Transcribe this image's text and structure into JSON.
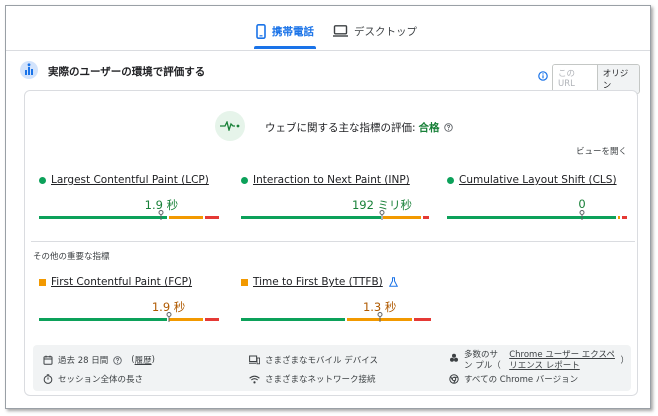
{
  "tabs": {
    "mobile_label": "携帯電話",
    "desktop_label": "デスクトップ"
  },
  "section": {
    "title": "実際のユーザーの環境で評価する",
    "toggle_url": "この URL",
    "toggle_origin": "オリジン"
  },
  "assessment": {
    "label": "ウェブに関する主な指標の評価:",
    "result": "合格",
    "expand": "ビューを開く"
  },
  "core_metrics": [
    {
      "name": "Largest Contentful Paint (LCP)",
      "value": "1.9 秒",
      "status": "good",
      "distribution": [
        0.73,
        0.19,
        0.08
      ],
      "marker_fraction": 0.68
    },
    {
      "name": "Interaction to Next Paint (INP)",
      "value": "192 ミリ秒",
      "status": "good",
      "distribution": [
        0.76,
        0.21,
        0.03
      ],
      "marker_fraction": 0.75
    },
    {
      "name": "Cumulative Layout Shift (CLS)",
      "value": "0",
      "status": "good",
      "distribution": [
        0.96,
        0.01,
        0.03
      ],
      "marker_fraction": 0.75
    }
  ],
  "other_title": "その他の重要な指標",
  "other_metrics": [
    {
      "name": "First Contentful Paint (FCP)",
      "value": "1.9 秒",
      "status": "ni",
      "distribution": [
        0.73,
        0.19,
        0.08
      ],
      "marker_fraction": 0.72
    },
    {
      "name": "Time to First Byte (TTFB)",
      "value": "1.3 秒",
      "status": "ni",
      "distribution": [
        0.56,
        0.35,
        0.09
      ],
      "marker_fraction": 0.73
    }
  ],
  "footer": {
    "period": "過去 28 日間",
    "history_link": "履歴",
    "devices": "さまざまなモバイル デバイス",
    "samples_prefix": "多数のサン プル（",
    "samples_link": "Chrome ユーザー エクスペリエンス レポート",
    "samples_suffix": "）",
    "session": "セッション全体の長さ",
    "network": "さまざまなネットワーク接続",
    "chrome_versions": "すべての Chrome バージョン"
  },
  "colors": {
    "good": "#0ca15a",
    "needs_improvement": "#f29900",
    "poor": "#e53935",
    "accent": "#1a73e8"
  }
}
